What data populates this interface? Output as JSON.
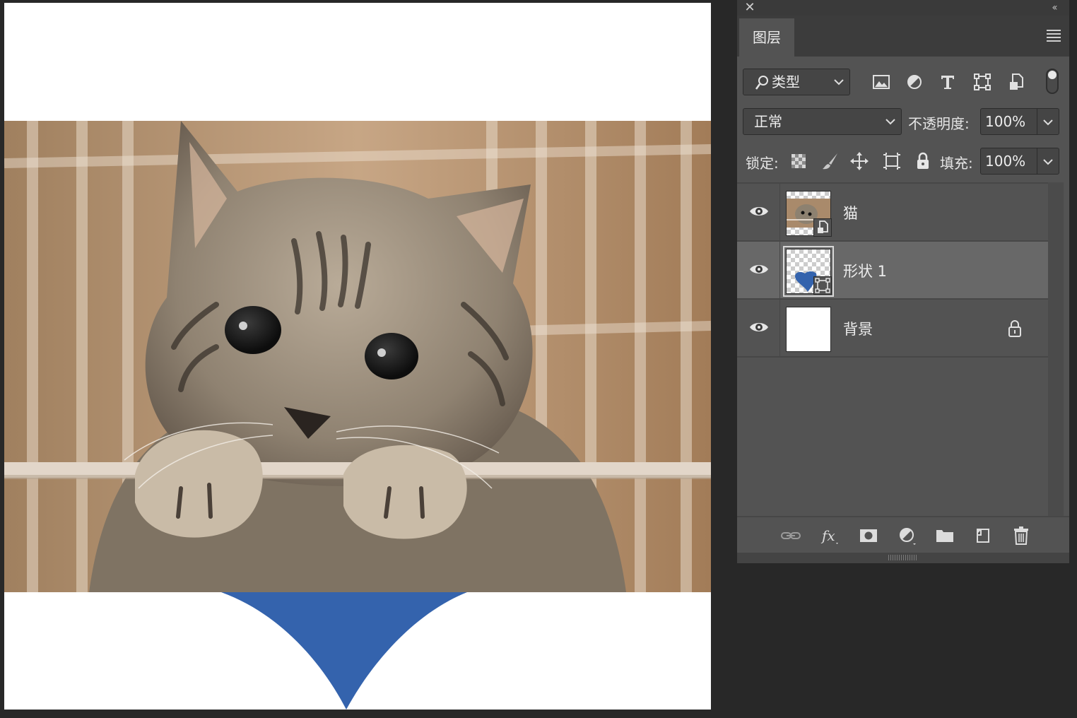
{
  "canvas": {
    "background": "#ffffff",
    "photo_layer": "猫",
    "shape_color": "#3463ad"
  },
  "panel": {
    "close_icon": "close-icon",
    "collapse_icon": "double-chevron-left-icon",
    "tab_label": "图层",
    "menu_icon": "hamburger-menu-icon",
    "filter": {
      "kind_label": "类型",
      "icons": [
        "image-filter-icon",
        "adjustment-filter-icon",
        "type-filter-icon",
        "shape-filter-icon",
        "smart-object-filter-icon"
      ]
    },
    "blend_mode": "正常",
    "opacity_label": "不透明度:",
    "opacity_value": "100%",
    "lock_label": "锁定:",
    "lock_icons": [
      "lock-transparent-pixels-icon",
      "lock-image-pixels-icon",
      "lock-position-icon",
      "lock-artboard-icon",
      "lock-all-icon"
    ],
    "fill_label": "填充:",
    "fill_value": "100%",
    "layers": [
      {
        "name": "猫",
        "visible": true,
        "type": "smart-object",
        "selected": false,
        "locked": false
      },
      {
        "name": "形状 1",
        "visible": true,
        "type": "shape",
        "selected": true,
        "locked": false
      },
      {
        "name": "背景",
        "visible": true,
        "type": "background",
        "selected": false,
        "locked": true
      }
    ],
    "footer_icons": [
      "link-layers-icon",
      "fx-icon",
      "add-mask-icon",
      "adjustment-layer-icon",
      "group-folder-icon",
      "new-layer-icon",
      "delete-icon"
    ],
    "colors": {
      "panel_bg": "#535353",
      "selected_row": "#686868",
      "heart_blue": "#3463ad"
    }
  }
}
